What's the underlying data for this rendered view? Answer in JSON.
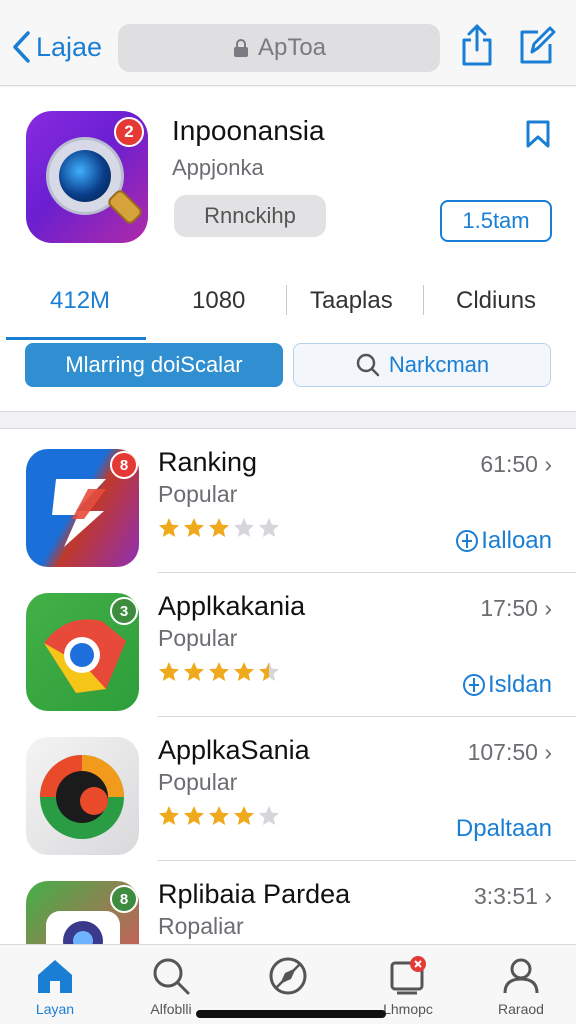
{
  "nav": {
    "back_label": "Lajae",
    "url_text": "ApToa"
  },
  "app": {
    "title": "Inpoonansia",
    "subtitle": "Appjonka",
    "badge": "2",
    "tag_label": "Rnnckihp",
    "get_label": "1.5tam"
  },
  "stats": [
    "412M",
    "1080",
    "Taaplas",
    "Cldiuns"
  ],
  "actions": {
    "primary": "Mlarring doiScalar",
    "secondary": "Narkcman"
  },
  "list": [
    {
      "title": "Ranking",
      "subtitle": "Popular",
      "time": "61:50",
      "action": "Ialloan",
      "rating": 3,
      "badge": "8"
    },
    {
      "title": "Applkakania",
      "subtitle": "Popular",
      "time": "17:50",
      "action": "Isldan",
      "rating": 4.5,
      "badge": "3"
    },
    {
      "title": "ApplkaSania",
      "subtitle": "Popular",
      "time": "107:50",
      "action": "Dpaltaan",
      "rating": 4,
      "badge": ""
    },
    {
      "title": "Rplibaia Pardea",
      "subtitle": "Ropaliar",
      "time": "3:3:51",
      "action": "",
      "rating": 0,
      "badge": "8"
    }
  ],
  "tabs": [
    {
      "label": "Layan",
      "icon": "home-icon",
      "active": true
    },
    {
      "label": "Alfoblli",
      "icon": "search-icon",
      "active": false
    },
    {
      "label": "",
      "icon": "compass-icon",
      "active": false
    },
    {
      "label": "Lhmopc",
      "icon": "inbox-icon",
      "active": false
    },
    {
      "label": "Raraod",
      "icon": "profile-icon",
      "active": false
    }
  ],
  "colors": {
    "accent": "#1a7fd4",
    "star": "#f0a81c",
    "badge": "#e53935"
  }
}
